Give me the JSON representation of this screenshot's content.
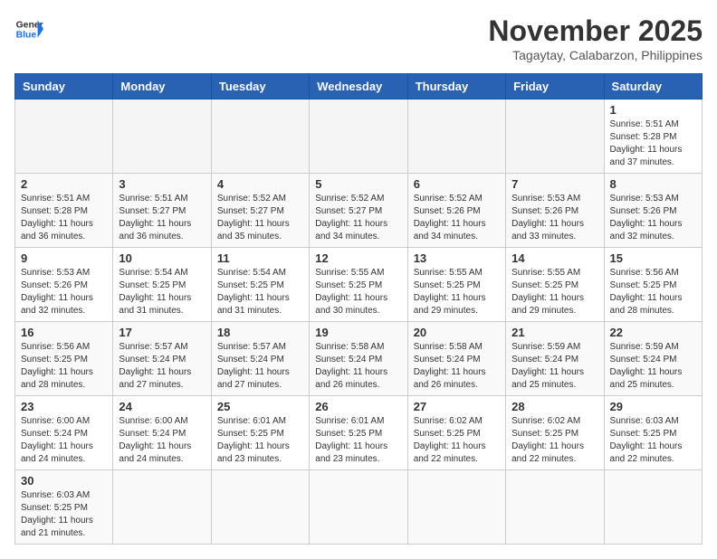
{
  "header": {
    "logo_text_general": "General",
    "logo_text_blue": "Blue",
    "month": "November 2025",
    "location": "Tagaytay, Calabarzon, Philippines"
  },
  "weekdays": [
    "Sunday",
    "Monday",
    "Tuesday",
    "Wednesday",
    "Thursday",
    "Friday",
    "Saturday"
  ],
  "weeks": [
    [
      {
        "day": "",
        "empty": true
      },
      {
        "day": "",
        "empty": true
      },
      {
        "day": "",
        "empty": true
      },
      {
        "day": "",
        "empty": true
      },
      {
        "day": "",
        "empty": true
      },
      {
        "day": "",
        "empty": true
      },
      {
        "day": "1",
        "sunrise": "Sunrise: 5:51 AM",
        "sunset": "Sunset: 5:28 PM",
        "daylight": "Daylight: 11 hours and 37 minutes."
      }
    ],
    [
      {
        "day": "2",
        "sunrise": "Sunrise: 5:51 AM",
        "sunset": "Sunset: 5:28 PM",
        "daylight": "Daylight: 11 hours and 36 minutes."
      },
      {
        "day": "3",
        "sunrise": "Sunrise: 5:51 AM",
        "sunset": "Sunset: 5:27 PM",
        "daylight": "Daylight: 11 hours and 36 minutes."
      },
      {
        "day": "4",
        "sunrise": "Sunrise: 5:52 AM",
        "sunset": "Sunset: 5:27 PM",
        "daylight": "Daylight: 11 hours and 35 minutes."
      },
      {
        "day": "5",
        "sunrise": "Sunrise: 5:52 AM",
        "sunset": "Sunset: 5:27 PM",
        "daylight": "Daylight: 11 hours and 34 minutes."
      },
      {
        "day": "6",
        "sunrise": "Sunrise: 5:52 AM",
        "sunset": "Sunset: 5:26 PM",
        "daylight": "Daylight: 11 hours and 34 minutes."
      },
      {
        "day": "7",
        "sunrise": "Sunrise: 5:53 AM",
        "sunset": "Sunset: 5:26 PM",
        "daylight": "Daylight: 11 hours and 33 minutes."
      },
      {
        "day": "8",
        "sunrise": "Sunrise: 5:53 AM",
        "sunset": "Sunset: 5:26 PM",
        "daylight": "Daylight: 11 hours and 32 minutes."
      }
    ],
    [
      {
        "day": "9",
        "sunrise": "Sunrise: 5:53 AM",
        "sunset": "Sunset: 5:26 PM",
        "daylight": "Daylight: 11 hours and 32 minutes."
      },
      {
        "day": "10",
        "sunrise": "Sunrise: 5:54 AM",
        "sunset": "Sunset: 5:25 PM",
        "daylight": "Daylight: 11 hours and 31 minutes."
      },
      {
        "day": "11",
        "sunrise": "Sunrise: 5:54 AM",
        "sunset": "Sunset: 5:25 PM",
        "daylight": "Daylight: 11 hours and 31 minutes."
      },
      {
        "day": "12",
        "sunrise": "Sunrise: 5:55 AM",
        "sunset": "Sunset: 5:25 PM",
        "daylight": "Daylight: 11 hours and 30 minutes."
      },
      {
        "day": "13",
        "sunrise": "Sunrise: 5:55 AM",
        "sunset": "Sunset: 5:25 PM",
        "daylight": "Daylight: 11 hours and 29 minutes."
      },
      {
        "day": "14",
        "sunrise": "Sunrise: 5:55 AM",
        "sunset": "Sunset: 5:25 PM",
        "daylight": "Daylight: 11 hours and 29 minutes."
      },
      {
        "day": "15",
        "sunrise": "Sunrise: 5:56 AM",
        "sunset": "Sunset: 5:25 PM",
        "daylight": "Daylight: 11 hours and 28 minutes."
      }
    ],
    [
      {
        "day": "16",
        "sunrise": "Sunrise: 5:56 AM",
        "sunset": "Sunset: 5:25 PM",
        "daylight": "Daylight: 11 hours and 28 minutes."
      },
      {
        "day": "17",
        "sunrise": "Sunrise: 5:57 AM",
        "sunset": "Sunset: 5:24 PM",
        "daylight": "Daylight: 11 hours and 27 minutes."
      },
      {
        "day": "18",
        "sunrise": "Sunrise: 5:57 AM",
        "sunset": "Sunset: 5:24 PM",
        "daylight": "Daylight: 11 hours and 27 minutes."
      },
      {
        "day": "19",
        "sunrise": "Sunrise: 5:58 AM",
        "sunset": "Sunset: 5:24 PM",
        "daylight": "Daylight: 11 hours and 26 minutes."
      },
      {
        "day": "20",
        "sunrise": "Sunrise: 5:58 AM",
        "sunset": "Sunset: 5:24 PM",
        "daylight": "Daylight: 11 hours and 26 minutes."
      },
      {
        "day": "21",
        "sunrise": "Sunrise: 5:59 AM",
        "sunset": "Sunset: 5:24 PM",
        "daylight": "Daylight: 11 hours and 25 minutes."
      },
      {
        "day": "22",
        "sunrise": "Sunrise: 5:59 AM",
        "sunset": "Sunset: 5:24 PM",
        "daylight": "Daylight: 11 hours and 25 minutes."
      }
    ],
    [
      {
        "day": "23",
        "sunrise": "Sunrise: 6:00 AM",
        "sunset": "Sunset: 5:24 PM",
        "daylight": "Daylight: 11 hours and 24 minutes."
      },
      {
        "day": "24",
        "sunrise": "Sunrise: 6:00 AM",
        "sunset": "Sunset: 5:24 PM",
        "daylight": "Daylight: 11 hours and 24 minutes."
      },
      {
        "day": "25",
        "sunrise": "Sunrise: 6:01 AM",
        "sunset": "Sunset: 5:25 PM",
        "daylight": "Daylight: 11 hours and 23 minutes."
      },
      {
        "day": "26",
        "sunrise": "Sunrise: 6:01 AM",
        "sunset": "Sunset: 5:25 PM",
        "daylight": "Daylight: 11 hours and 23 minutes."
      },
      {
        "day": "27",
        "sunrise": "Sunrise: 6:02 AM",
        "sunset": "Sunset: 5:25 PM",
        "daylight": "Daylight: 11 hours and 22 minutes."
      },
      {
        "day": "28",
        "sunrise": "Sunrise: 6:02 AM",
        "sunset": "Sunset: 5:25 PM",
        "daylight": "Daylight: 11 hours and 22 minutes."
      },
      {
        "day": "29",
        "sunrise": "Sunrise: 6:03 AM",
        "sunset": "Sunset: 5:25 PM",
        "daylight": "Daylight: 11 hours and 22 minutes."
      }
    ],
    [
      {
        "day": "30",
        "sunrise": "Sunrise: 6:03 AM",
        "sunset": "Sunset: 5:25 PM",
        "daylight": "Daylight: 11 hours and 21 minutes.",
        "last": true
      },
      {
        "day": "",
        "empty": true,
        "last": true
      },
      {
        "day": "",
        "empty": true,
        "last": true
      },
      {
        "day": "",
        "empty": true,
        "last": true
      },
      {
        "day": "",
        "empty": true,
        "last": true
      },
      {
        "day": "",
        "empty": true,
        "last": true
      },
      {
        "day": "",
        "empty": true,
        "last": true
      }
    ]
  ]
}
